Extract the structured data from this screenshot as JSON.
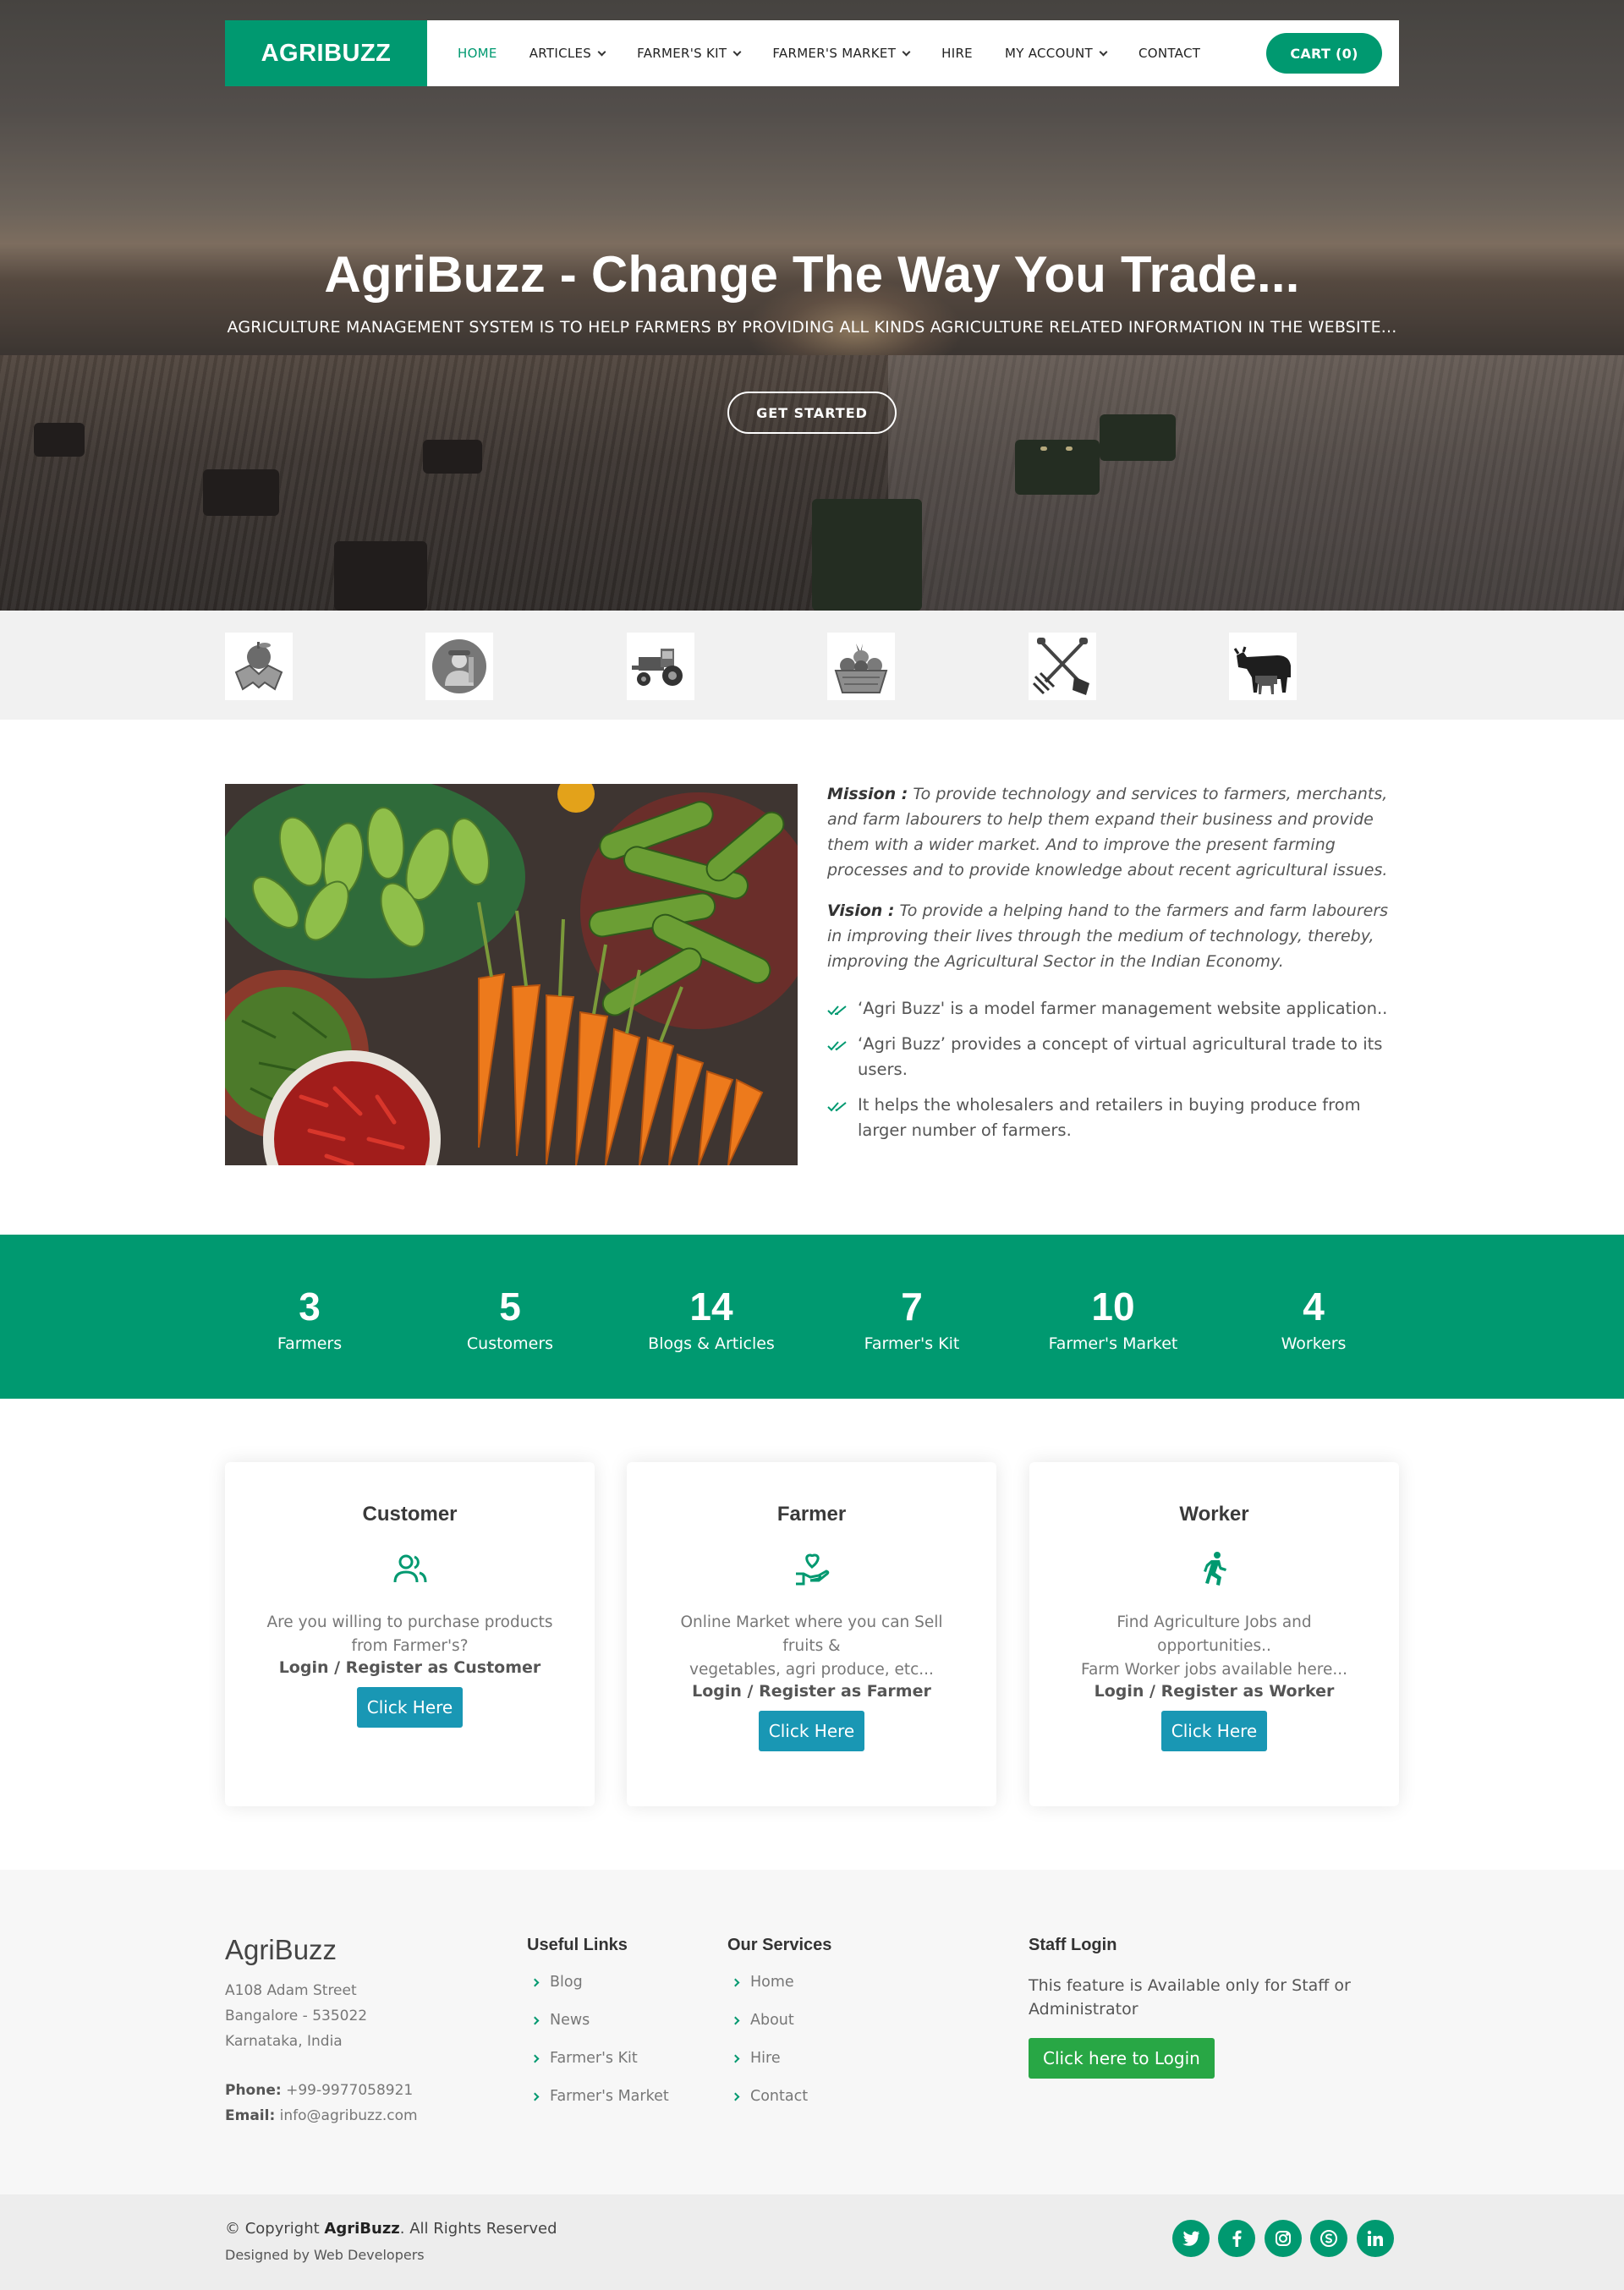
{
  "nav": {
    "logo": "AGRIBUZZ",
    "items": [
      {
        "label": "HOME",
        "dropdown": false,
        "active": true
      },
      {
        "label": "ARTICLES",
        "dropdown": true,
        "active": false
      },
      {
        "label": "FARMER'S KIT",
        "dropdown": true,
        "active": false
      },
      {
        "label": "FARMER'S MARKET",
        "dropdown": true,
        "active": false
      },
      {
        "label": "HIRE",
        "dropdown": false,
        "active": false
      },
      {
        "label": "MY ACCOUNT",
        "dropdown": true,
        "active": false
      },
      {
        "label": "CONTACT",
        "dropdown": false,
        "active": false
      }
    ],
    "cart_label": "CART (0)"
  },
  "hero": {
    "title": "AgriBuzz - Change The Way You Trade...",
    "subtitle": "AGRICULTURE MANAGEMENT SYSTEM IS TO HELP FARMERS BY PROVIDING ALL KINDS AGRICULTURE RELATED INFORMATION IN THE WEBSITE...",
    "button": "GET STARTED"
  },
  "category_icons": [
    "handshake-apple-icon",
    "farmer-avatar-icon",
    "tractor-icon",
    "fruit-basket-icon",
    "rake-shovel-icon",
    "cow-calf-icon"
  ],
  "about": {
    "mission_label": "Mission :",
    "mission_text": "To provide technology and services to farmers, merchants, and farm labourers to help them expand their business and provide them with a wider market. And to improve the present farming processes and to provide knowledge about recent agricultural issues.",
    "vision_label": "Vision :",
    "vision_text": "To provide a helping hand to the farmers and farm labourers in improving their lives through the medium of technology, thereby, improving the Agricultural Sector in the Indian Economy.",
    "points": [
      "‘Agri Buzz' is a model farmer management website application..",
      "‘Agri Buzz’ provides a concept of virtual agricultural trade to its users.",
      "It helps the wholesalers and retailers in buying produce from larger number of farmers."
    ]
  },
  "stats": [
    {
      "value": "3",
      "label": "Farmers"
    },
    {
      "value": "5",
      "label": "Customers"
    },
    {
      "value": "14",
      "label": "Blogs & Articles"
    },
    {
      "value": "7",
      "label": "Farmer's Kit"
    },
    {
      "value": "10",
      "label": "Farmer's Market"
    },
    {
      "value": "4",
      "label": "Workers"
    }
  ],
  "cards": [
    {
      "title": "Customer",
      "icon": "users-icon",
      "desc1": "Are you willing to purchase products",
      "desc2": "from Farmer's?",
      "register": "Login / Register as Customer",
      "button": "Click Here"
    },
    {
      "title": "Farmer",
      "icon": "hand-heart-icon",
      "desc1": "Online Market where you can Sell fruits &",
      "desc2": "vegetables, agri produce, etc...",
      "register": "Login / Register as Farmer",
      "button": "Click Here"
    },
    {
      "title": "Worker",
      "icon": "running-person-icon",
      "desc1": "Find Agriculture Jobs and opportunities..",
      "desc2": "Farm Worker jobs available here...",
      "register": "Login / Register as Worker",
      "button": "Click Here"
    }
  ],
  "footer": {
    "brand": "AgriBuzz",
    "address": [
      "A108 Adam Street",
      "Bangalore - 535022",
      "Karnataka, India"
    ],
    "phone_label": "Phone:",
    "phone": "+99-9977058921",
    "email_label": "Email:",
    "email": "info@agribuzz.com",
    "useful_links_title": "Useful Links",
    "useful_links": [
      "Blog",
      "News",
      "Farmer's Kit",
      "Farmer's Market"
    ],
    "services_title": "Our Services",
    "services": [
      "Home",
      "About",
      "Hire",
      "Contact"
    ],
    "staff_title": "Staff Login",
    "staff_text": "This feature is Available only for Staff or Administrator",
    "staff_button": "Click here to Login",
    "copyright_prefix": "© Copyright",
    "copyright_brand": "AgriBuzz",
    "copyright_suffix": ". All Rights Reserved",
    "designed_by": "Designed by Web Developers",
    "social": [
      "twitter-icon",
      "facebook-icon",
      "instagram-icon",
      "skype-icon",
      "linkedin-icon"
    ]
  },
  "colors": {
    "primary": "#009970",
    "button_blue": "#1997b4",
    "login_green": "#28a745"
  }
}
